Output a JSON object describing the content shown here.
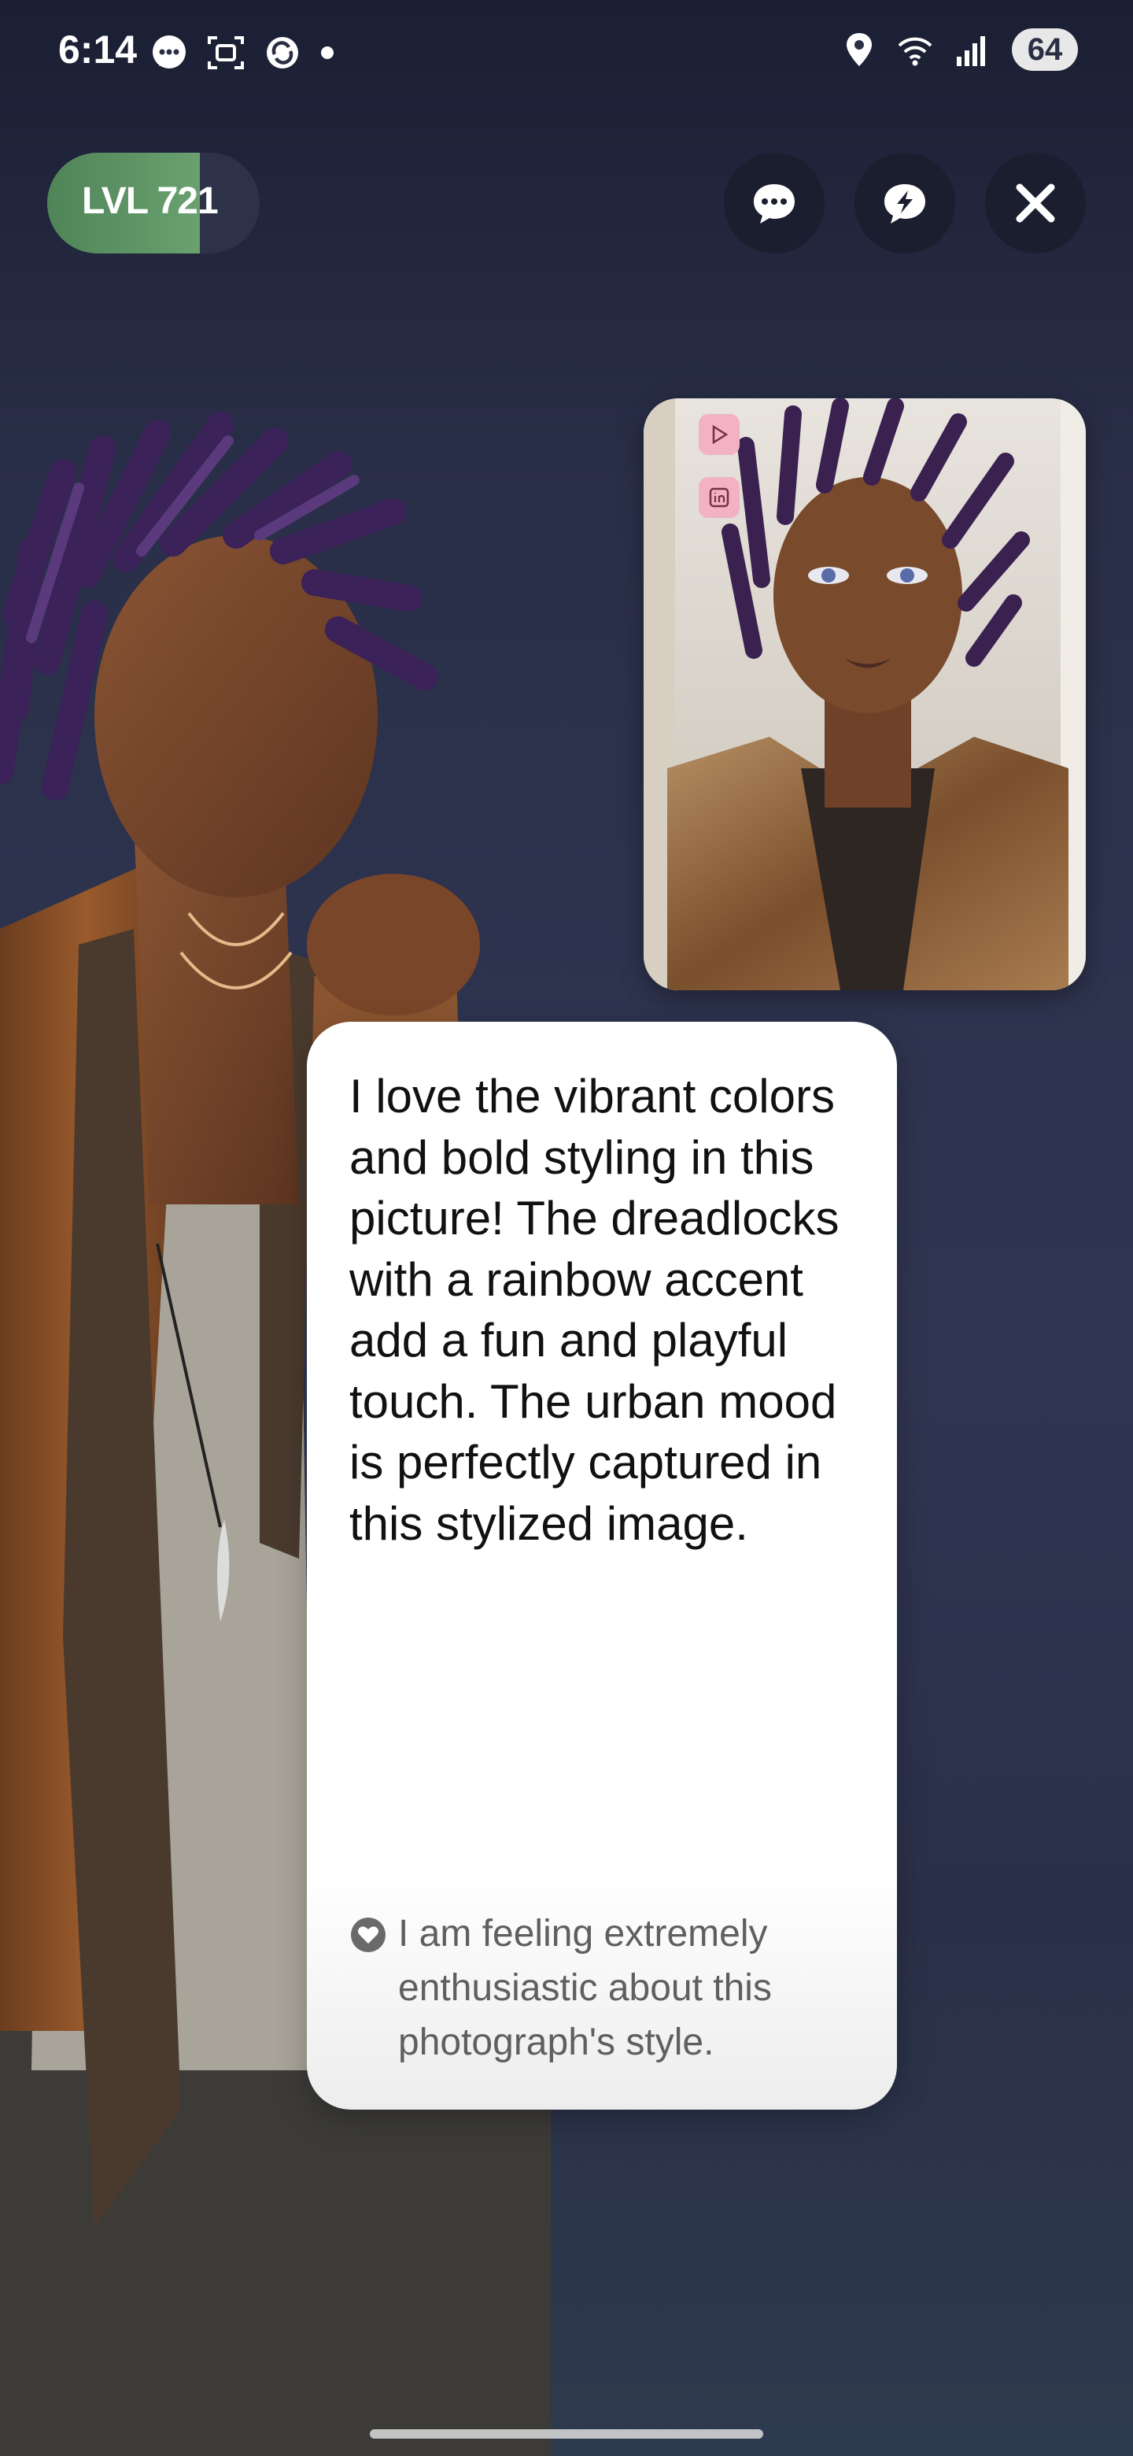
{
  "status_bar": {
    "time": "6:14",
    "left_icons": [
      "messenger-icon",
      "screenshot-icon",
      "sync-icon",
      "dot-icon"
    ],
    "right_icons": [
      "location-icon",
      "wifi-icon",
      "signal-icon"
    ],
    "battery": "64"
  },
  "header": {
    "level_label": "LVL 721",
    "level_progress": 0.72,
    "level_color": "#5f9665",
    "buttons": [
      "chat-icon",
      "bolt-chat-icon",
      "close-icon"
    ]
  },
  "thumbnail": {
    "side_icons": [
      "play-icon",
      "linkedin-icon"
    ]
  },
  "message": {
    "text": "I love the vibrant colors and bold styling in this picture! The dreadlocks with a rainbow accent add a fun and playful touch. The urban mood is perfectly captured in this stylized image.",
    "mood_icon": "heart-icon",
    "mood_text": "I am feeling extremely enthusiastic about this photograph's style."
  },
  "colors": {
    "background": "#2a2f49",
    "card": "#ffffff",
    "button": "#1a1e2e"
  }
}
